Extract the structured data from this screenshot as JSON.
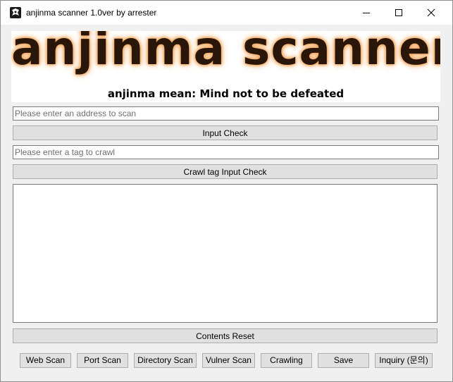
{
  "window": {
    "title": "anjinma scanner 1.0ver by arrester",
    "controls": {
      "minimize": "minimize-icon",
      "maximize": "maximize-icon",
      "close": "close-icon"
    }
  },
  "banner": {
    "logo_text": "anjinma scanner",
    "tagline": "anjinma mean: Mind not to be defeated"
  },
  "address_input": {
    "value": "",
    "placeholder": "Please enter an address to scan"
  },
  "input_check_button": "Input Check",
  "tag_input": {
    "value": "",
    "placeholder": "Please enter a tag to crawl"
  },
  "crawl_tag_check_button": "Crawl tag Input Check",
  "output": {
    "content": ""
  },
  "contents_reset_button": "Contents Reset",
  "actions": {
    "web_scan": "Web Scan",
    "port_scan": "Port Scan",
    "directory_scan": "Directory Scan",
    "vulner_scan": "Vulner Scan",
    "crawling": "Crawling",
    "save": "Save",
    "inquiry": "Inquiry (문의)"
  },
  "colors": {
    "window_bg": "#f0f0f0",
    "button_bg": "#e1e1e1",
    "logo_text": "#2a1608",
    "logo_glow": "#f0a050"
  }
}
